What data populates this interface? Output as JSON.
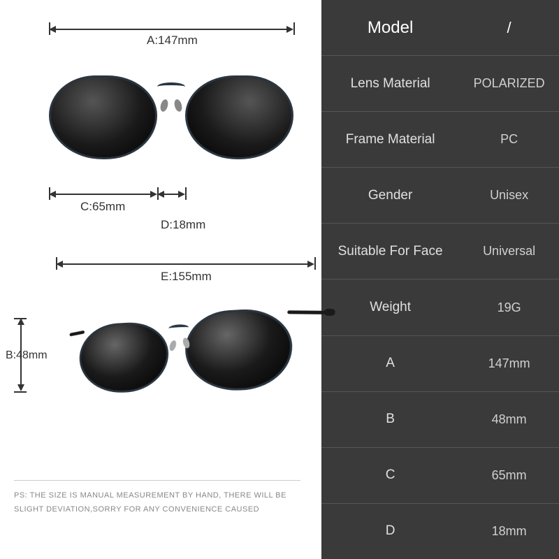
{
  "specs": [
    {
      "label": "Model",
      "value": "/"
    },
    {
      "label": "Lens Material",
      "value": "POLARIZED"
    },
    {
      "label": "Frame Material",
      "value": "PC"
    },
    {
      "label": "Gender",
      "value": "Unisex"
    },
    {
      "label": "Suitable For Face",
      "value": "Universal"
    },
    {
      "label": "Weight",
      "value": "19G"
    },
    {
      "label": "A",
      "value": "147mm"
    },
    {
      "label": "B",
      "value": "48mm"
    },
    {
      "label": "C",
      "value": "65mm"
    },
    {
      "label": "D",
      "value": "18mm"
    }
  ],
  "dimensions": {
    "A": "A:147mm",
    "B": "B:48mm",
    "C": "C:65mm",
    "D": "D:18mm",
    "E": "E:155mm"
  },
  "disclaimer": "PS: THE SIZE IS MANUAL MEASUREMENT BY HAND, THERE WILL BE SLIGHT DEVIATION,SORRY FOR ANY CONVENIENCE CAUSED"
}
